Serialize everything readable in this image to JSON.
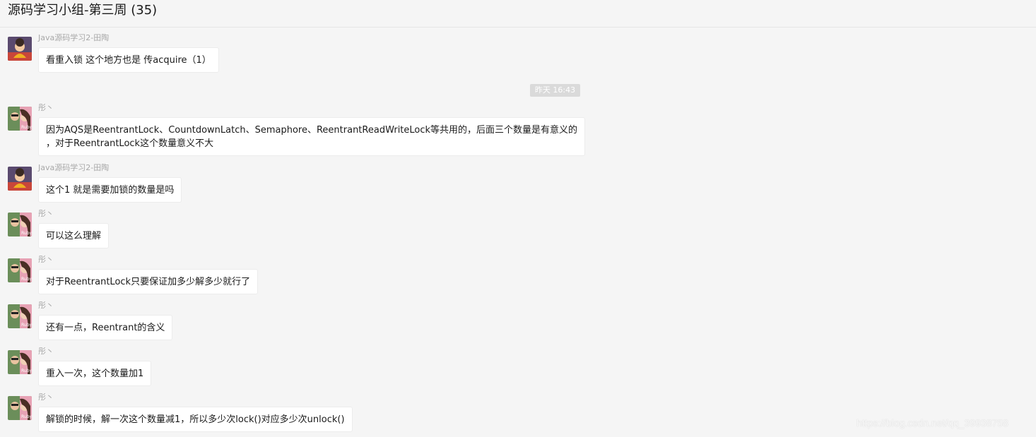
{
  "header": {
    "title": "源码学习小组-第三周 (35)"
  },
  "divider": {
    "time": "昨天 16:43"
  },
  "messages": [
    {
      "sender": "Java源码学习2-田陶",
      "avatar": "avatar-a",
      "lines": [
        "看重入锁 这个地方也是 传acquire（1）"
      ]
    },
    {
      "sender": "彤丶",
      "avatar": "avatar-b",
      "lines": [
        "因为AQS是ReentrantLock、CountdownLatch、Semaphore、ReentrantReadWriteLock等共用的，后面三个数量是有意义的",
        "，对于ReentrantLock这个数量意义不大"
      ]
    },
    {
      "sender": "Java源码学习2-田陶",
      "avatar": "avatar-a",
      "lines": [
        "这个1 就是需要加锁的数量是吗"
      ]
    },
    {
      "sender": "彤丶",
      "avatar": "avatar-b",
      "lines": [
        "可以这么理解"
      ]
    },
    {
      "sender": "彤丶",
      "avatar": "avatar-b",
      "lines": [
        "对于ReentrantLock只要保证加多少解多少就行了"
      ]
    },
    {
      "sender": "彤丶",
      "avatar": "avatar-b",
      "lines": [
        "还有一点，Reentrant的含义"
      ]
    },
    {
      "sender": "彤丶",
      "avatar": "avatar-b",
      "lines": [
        "重入一次，这个数量加1"
      ]
    },
    {
      "sender": "彤丶",
      "avatar": "avatar-b",
      "lines": [
        "解锁的时候，解一次这个数量减1，所以多少次lock()对应多少次unlock()"
      ]
    }
  ],
  "watermark": "https://blog.csdn.net/qq_39938758",
  "colors": {
    "background": "#f5f5f5",
    "bubble": "#ffffff",
    "sender_text": "#a8a8a8",
    "time_badge": "#dadada"
  }
}
